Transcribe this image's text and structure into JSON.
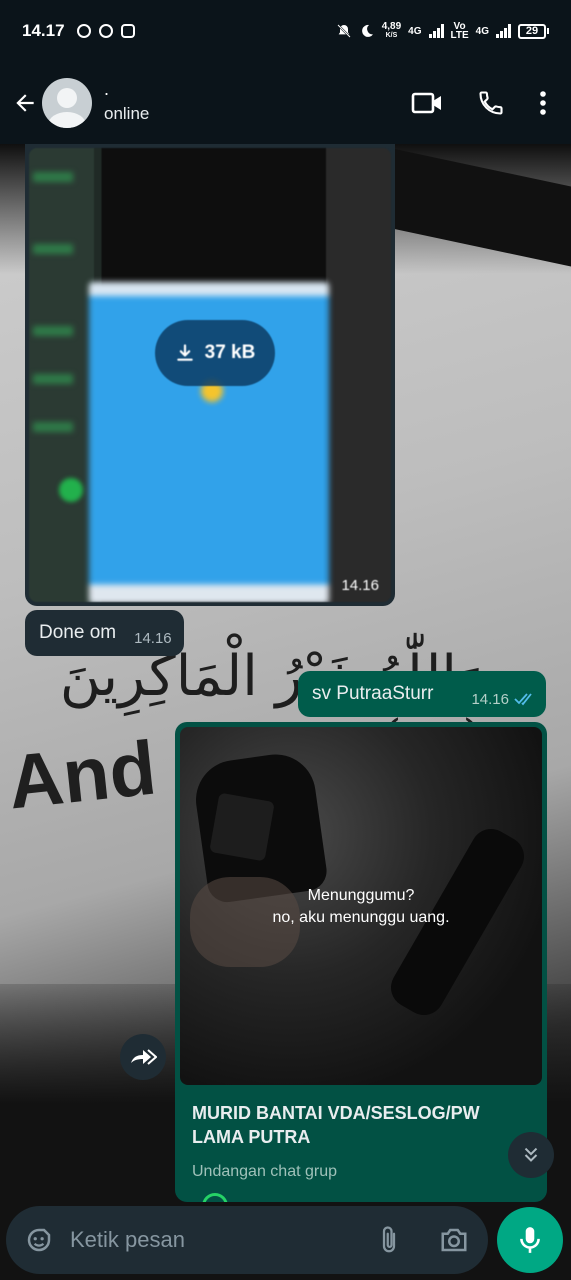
{
  "status_bar": {
    "time": "14.17",
    "net_speed": "4,89",
    "net_speed_unit": "K/S",
    "net1": "4G",
    "net2_top": "Vo",
    "net2_bottom": "LTE",
    "net3": "4G",
    "battery": "29",
    "icons": [
      "whatsapp-icon",
      "b-icon",
      "chat-icon",
      "mute-icon",
      "moon-icon",
      "signal-icon",
      "battery-icon"
    ]
  },
  "header": {
    "contact_name": ".",
    "contact_status": "online",
    "icons": [
      "back-arrow-icon",
      "avatar",
      "video-call-icon",
      "voice-call-icon",
      "more-vert-icon"
    ]
  },
  "messages": {
    "image": {
      "size": "37 kB",
      "time": "14.16"
    },
    "incoming_text": {
      "text": "Done om",
      "time": "14.16"
    },
    "outgoing_text": {
      "text": "sv PutraaSturr",
      "time": "14.16"
    },
    "invite": {
      "caption_line1": "Menunggumu?",
      "caption_line2": "no, aku menunggu uang.",
      "title": "MURID BANTAI VDA/SESLOG/PW LAMA PUTRA",
      "subtitle": "Undangan chat grup"
    }
  },
  "wallpaper": {
    "arabic": "وَاللّٰهُ خَيْرُ الْمَاكِرِينَ (٣٠)",
    "english": "And A"
  },
  "composer": {
    "placeholder": "Ketik pesan"
  },
  "colors": {
    "background": "#0b141a",
    "incoming_bubble": "#1f2c34",
    "outgoing_bubble": "#005c4b",
    "accent": "#00a884",
    "read_ticks": "#53bdeb"
  }
}
